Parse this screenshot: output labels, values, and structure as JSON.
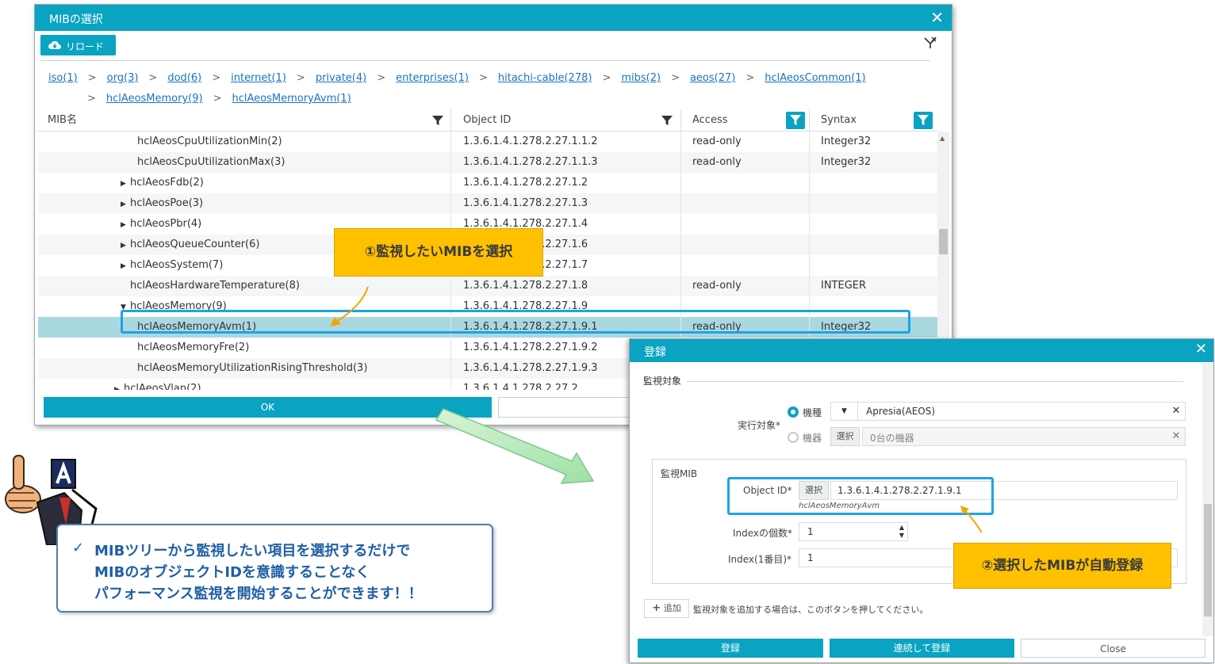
{
  "mib_dialog": {
    "title": "MIBの選択",
    "close_glyph": "✕",
    "reload_label": "リロード",
    "breadcrumbs": [
      "iso(1)",
      "org(3)",
      "dod(6)",
      "internet(1)",
      "private(4)",
      "enterprises(1)",
      "hitachi-cable(278)",
      "mibs(2)",
      "aeos(27)",
      "hclAeosCommon(1)",
      "hclAeosMemory(9)",
      "hclAeosMemoryAvm(1)"
    ],
    "breadcrumb_sep": ">",
    "columns": [
      "MIB名",
      "Object ID",
      "Access",
      "Syntax"
    ],
    "rows": [
      {
        "name": "hclAeosCpuUtilizationMin(2)",
        "oid": "1.3.6.1.4.1.278.2.27.1.1.2",
        "access": "read-only",
        "syntax": "Integer32",
        "expander": ""
      },
      {
        "name": "hclAeosCpuUtilizationMax(3)",
        "oid": "1.3.6.1.4.1.278.2.27.1.1.3",
        "access": "read-only",
        "syntax": "Integer32",
        "expander": ""
      },
      {
        "name": "hclAeosFdb(2)",
        "oid": "1.3.6.1.4.1.278.2.27.1.2",
        "access": "",
        "syntax": "",
        "expander": "▶"
      },
      {
        "name": "hclAeosPoe(3)",
        "oid": "1.3.6.1.4.1.278.2.27.1.3",
        "access": "",
        "syntax": "",
        "expander": "▶"
      },
      {
        "name": "hclAeosPbr(4)",
        "oid": "1.3.6.1.4.1.278.2.27.1.4",
        "access": "",
        "syntax": "",
        "expander": "▶"
      },
      {
        "name": "hclAeosQueueCounter(6)",
        "oid": "1.3.6.1.4.1.278.2.27.1.6",
        "access": "",
        "syntax": "",
        "expander": "▶"
      },
      {
        "name": "hclAeosSystem(7)",
        "oid": "1.3.6.1.4.1.278.2.27.1.7",
        "access": "",
        "syntax": "",
        "expander": "▶"
      },
      {
        "name": "hclAeosHardwareTemperature(8)",
        "oid": "1.3.6.1.4.1.278.2.27.1.8",
        "access": "read-only",
        "syntax": "INTEGER",
        "expander": ""
      },
      {
        "name": "hclAeosMemory(9)",
        "oid": "1.3.6.1.4.1.278.2.27.1.9",
        "access": "",
        "syntax": "",
        "expander": "▼"
      },
      {
        "name": "hclAeosMemoryAvm(1)",
        "oid": "1.3.6.1.4.1.278.2.27.1.9.1",
        "access": "read-only",
        "syntax": "Integer32",
        "expander": ""
      },
      {
        "name": "hclAeosMemoryFre(2)",
        "oid": "1.3.6.1.4.1.278.2.27.1.9.2",
        "access": "",
        "syntax": "",
        "expander": ""
      },
      {
        "name": "hclAeosMemoryUtilizationRisingThreshold(3)",
        "oid": "1.3.6.1.4.1.278.2.27.1.9.3",
        "access": "",
        "syntax": "",
        "expander": ""
      },
      {
        "name": "hclAeosVlan(2)",
        "oid": "1.3.6.1.4.1.278.2.27.2",
        "access": "",
        "syntax": "",
        "expander": "▶"
      }
    ],
    "selected_row_index": 9,
    "ok_label": "OK"
  },
  "callout_1": "①監視したいMIBを選択",
  "callout_2": "②選択したMIBが自動登録",
  "register_dialog": {
    "title": "登録",
    "close_glyph": "✕",
    "section_title": "監視対象",
    "target_label": "実行対象*",
    "radio_model_label": "機種",
    "radio_device_label": "機器",
    "model_dropdown_glyph": "▼",
    "model_value": "Apresia(AEOS)",
    "device_select_label": "選択",
    "device_value": "0台の機器",
    "mib_section_label": "監視MIB",
    "oid_label": "Object ID*",
    "oid_select_label": "選択",
    "oid_value": "1.3.6.1.4.1.278.2.27.1.9.1",
    "oid_name": "hclAeosMemoryAvm",
    "index_count_label": "Indexの個数*",
    "index_count_value": "1",
    "index_first_label": "Index(1番目)*",
    "index_first_value": "1",
    "add_label": "追加",
    "add_hint": "監視対象を追加する場合は、このボタンを押してください。",
    "register_label": "登録",
    "register_continue_label": "連続して登録",
    "close_label": "Close"
  },
  "message": {
    "check_glyph": "✓",
    "lines": [
      "MIBツリーから監視したい項目を選択するだけで",
      "MIBのオブジェクトIDを意識することなく",
      "パフォーマンス監視を開始することができます！！"
    ]
  },
  "colors": {
    "accent": "#0aa3c2",
    "selected_row": "#a9d8e0",
    "callout": "#ffc000",
    "highlight_frame": "#1da3e6",
    "message_text": "#1f5fa6"
  }
}
